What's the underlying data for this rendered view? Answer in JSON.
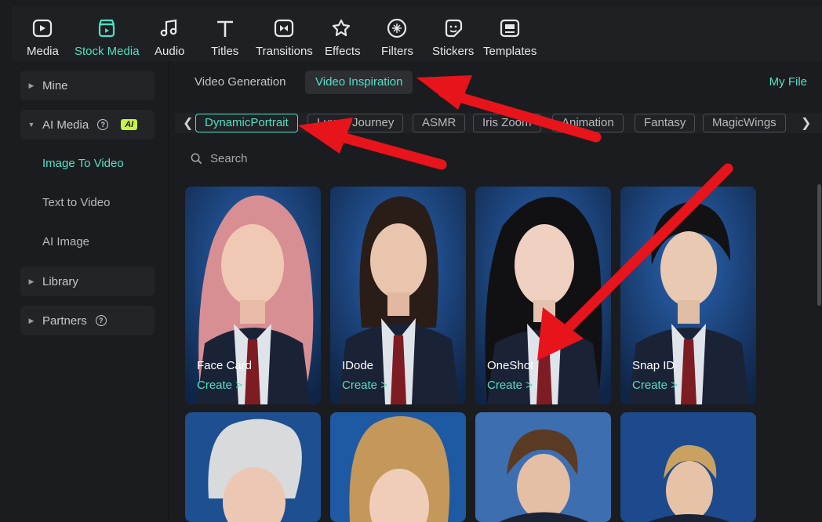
{
  "toolbar": {
    "items": [
      {
        "label": "Media",
        "icon": "media-icon"
      },
      {
        "label": "Stock Media",
        "icon": "stock-media-icon",
        "active": true
      },
      {
        "label": "Audio",
        "icon": "music-note-icon"
      },
      {
        "label": "Titles",
        "icon": "title-t-icon"
      },
      {
        "label": "Transitions",
        "icon": "transitions-icon"
      },
      {
        "label": "Effects",
        "icon": "effects-icon"
      },
      {
        "label": "Filters",
        "icon": "filters-icon"
      },
      {
        "label": "Stickers",
        "icon": "stickers-icon"
      },
      {
        "label": "Templates",
        "icon": "templates-icon"
      }
    ]
  },
  "sidebar": {
    "mine": "Mine",
    "ai_media": "AI Media",
    "ai_badge": "AI",
    "image_to_video": "Image To Video",
    "text_to_video": "Text to Video",
    "ai_image": "AI Image",
    "library": "Library",
    "partners": "Partners"
  },
  "tabs": {
    "video_generation": "Video Generation",
    "video_inspiration": "Video Inspiration",
    "my_file": "My File"
  },
  "chips": [
    "DynamicPortrait",
    "LuxuryJourney",
    "ASMR",
    "Iris Zoom",
    "Animation",
    "Fantasy",
    "MagicWings"
  ],
  "search": {
    "placeholder": "Search"
  },
  "cards": [
    {
      "name": "Face Card",
      "create": "Create >"
    },
    {
      "name": "IDode",
      "create": "Create >"
    },
    {
      "name": "OneShot",
      "create": "Create >"
    },
    {
      "name": "Snap ID",
      "create": "Create >"
    }
  ],
  "colors": {
    "accent": "#52e0c7",
    "arrow": "#e8141c",
    "ai_badge": "#c6f24a"
  }
}
